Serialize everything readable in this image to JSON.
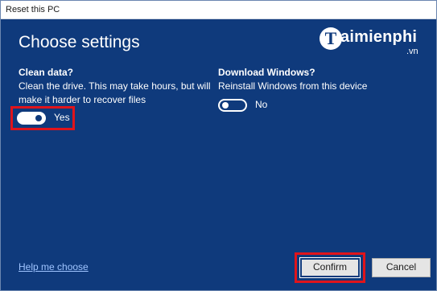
{
  "window": {
    "title": "Reset this PC"
  },
  "heading": "Choose settings",
  "watermark": {
    "letter": "T",
    "word": "aimienphi",
    "tld": ".vn"
  },
  "clean_data": {
    "title": "Clean data?",
    "description_line1": "Clean the drive. This may take hours, but will",
    "description_line2": "make it harder to recover files",
    "toggle_state": "on",
    "toggle_label": "Yes"
  },
  "download_windows": {
    "title": "Download Windows?",
    "description": "Reinstall Windows from this device",
    "toggle_state": "off",
    "toggle_label": "No"
  },
  "footer": {
    "help_link": "Help me choose",
    "confirm_label": "Confirm",
    "cancel_label": "Cancel"
  },
  "colors": {
    "background": "#0f3a7c",
    "highlight": "#e0141b",
    "link": "#9fc4ff"
  }
}
